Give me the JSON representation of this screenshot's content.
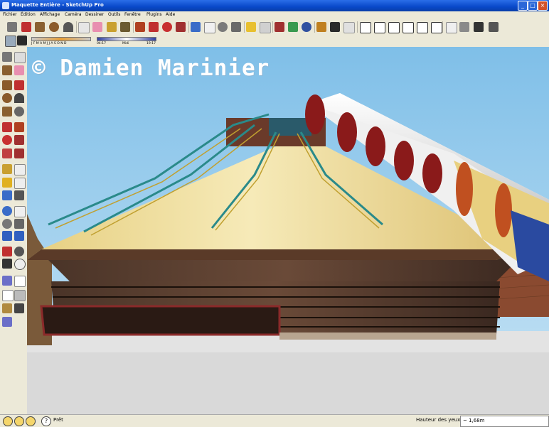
{
  "window": {
    "title": "Maquette Entière - SketchUp Pro",
    "min": "_",
    "max": "□",
    "close": "×"
  },
  "menu": [
    "Fichier",
    "Édition",
    "Affichage",
    "Caméra",
    "Dessiner",
    "Outils",
    "Fenêtre",
    "Plugins",
    "Aide"
  ],
  "shadows": {
    "months": "J F M A M J J A S O N D",
    "time_start": "04:17",
    "time_mid": "Midi",
    "time_end": "19:17"
  },
  "watermark": "© Damien Marinier",
  "status": {
    "message": "Prêt",
    "measure_label": "Hauteur des yeux",
    "measure_value": "~ 1,68m"
  },
  "colors": {
    "sky": "#88c4ec",
    "ground": "#d8d8d8",
    "roof": "#f1e2a6",
    "wall": "#3f2a1e",
    "truss": "#b0983a"
  }
}
